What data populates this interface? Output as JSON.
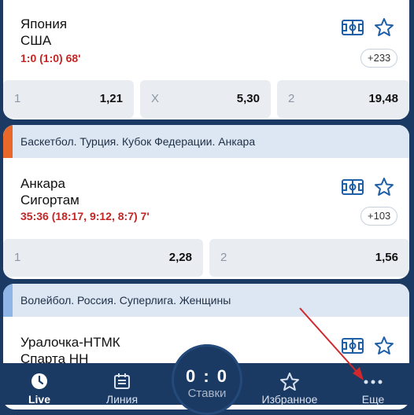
{
  "events": [
    {
      "team1": "Япония",
      "team2": "США",
      "score": "1:0 (1:0) 68'",
      "more_markets": "+233",
      "odds": [
        {
          "label": "1",
          "value": "1,21"
        },
        {
          "label": "X",
          "value": "5,30"
        },
        {
          "label": "2",
          "value": "19,48"
        }
      ]
    },
    {
      "league": "Баскетбол. Турция. Кубок Федерации. Анкара",
      "accent_color": "#e8682a",
      "team1": "Анкара",
      "team2": "Сигортам",
      "score": "35:36 (18:17, 9:12, 8:7) 7'",
      "more_markets": "+103",
      "odds": [
        {
          "label": "1",
          "value": "2,28"
        },
        {
          "label": "2",
          "value": "1,56"
        }
      ]
    },
    {
      "league": "Волейбол. Россия. Суперлига. Женщины",
      "accent_color": "#8fb4e6",
      "team1": "Уралочка-НТМК",
      "team2": "Спарта НН"
    }
  ],
  "bet_slip": {
    "score": "0 : 0",
    "label": "Ставки"
  },
  "nav": {
    "live": "Live",
    "line": "Линия",
    "favorites": "Избранное",
    "more": "Еще"
  },
  "colors": {
    "score_red": "#c62424",
    "navbar": "#1b3a63",
    "arrow": "#d0282c"
  }
}
